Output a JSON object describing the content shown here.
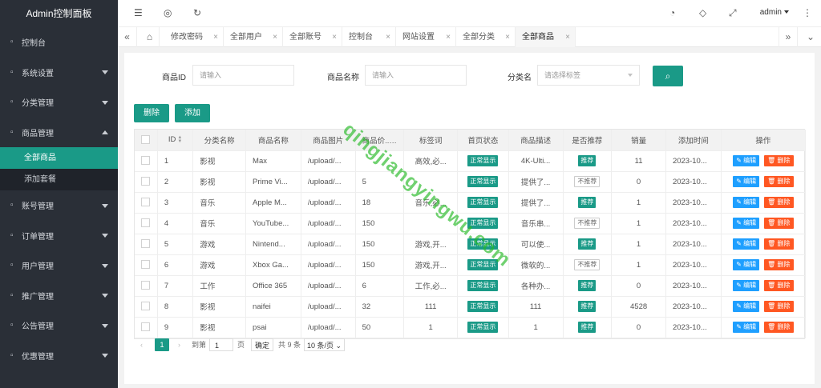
{
  "brand": "Admin控制面板",
  "sidebar": {
    "items": [
      {
        "label": "控制台",
        "icon": "home-icon",
        "caret": ""
      },
      {
        "label": "系统设置",
        "icon": "gear-icon",
        "caret": "down"
      },
      {
        "label": "分类管理",
        "icon": "category-icon",
        "caret": "down"
      },
      {
        "label": "商品管理",
        "icon": "product-icon",
        "caret": "up"
      }
    ],
    "submenu": [
      {
        "label": "全部商品",
        "active": true
      },
      {
        "label": "添加套餐",
        "active": false
      }
    ],
    "items_after": [
      {
        "label": "账号管理",
        "icon": "account-icon",
        "caret": "down"
      },
      {
        "label": "订单管理",
        "icon": "order-icon",
        "caret": "down"
      },
      {
        "label": "用户管理",
        "icon": "user-icon",
        "caret": "down"
      },
      {
        "label": "推广管理",
        "icon": "share-icon",
        "caret": "down"
      },
      {
        "label": "公告管理",
        "icon": "notice-icon",
        "caret": "down"
      },
      {
        "label": "优惠管理",
        "icon": "coupon-icon",
        "caret": "down"
      }
    ]
  },
  "header": {
    "user": "admin"
  },
  "tabs": [
    "修改密码",
    "全部用户",
    "全部账号",
    "控制台",
    "网站设置",
    "全部分类",
    "全部商品"
  ],
  "filters": {
    "id_label": "商品ID",
    "id_placeholder": "请输入",
    "name_label": "商品名称",
    "name_placeholder": "请输入",
    "category_label": "分类名",
    "category_placeholder": "请选择标签"
  },
  "actions": {
    "delete": "删除",
    "add": "添加"
  },
  "table": {
    "columns": [
      "ID",
      "分类名称",
      "商品名称",
      "商品图片",
      "商品价...",
      "标签词",
      "首页状态",
      "商品描述",
      "是否推荐",
      "销量",
      "添加时间",
      "操作"
    ],
    "rows": [
      {
        "id": "1",
        "category": "影视",
        "name": "Max",
        "image": "/upload/...",
        "price": "",
        "tags": "高效,必...",
        "status": "正常显示",
        "desc": "4K-Ulti...",
        "recommend": "推荐",
        "sales": "11",
        "time": "2023-10..."
      },
      {
        "id": "2",
        "category": "影视",
        "name": "Prime Vi...",
        "image": "/upload/...",
        "price": "5",
        "tags": "",
        "status": "正常显示",
        "desc": "提供了...",
        "recommend": "不推荐",
        "sales": "0",
        "time": "2023-10..."
      },
      {
        "id": "3",
        "category": "音乐",
        "name": "Apple M...",
        "image": "/upload/...",
        "price": "18",
        "tags": "音乐,必...",
        "status": "正常显示",
        "desc": "提供了...",
        "recommend": "推荐",
        "sales": "1",
        "time": "2023-10..."
      },
      {
        "id": "4",
        "category": "音乐",
        "name": "YouTube...",
        "image": "/upload/...",
        "price": "150",
        "tags": "",
        "status": "正常显示",
        "desc": "音乐串...",
        "recommend": "不推荐",
        "sales": "1",
        "time": "2023-10..."
      },
      {
        "id": "5",
        "category": "游戏",
        "name": "Nintend...",
        "image": "/upload/...",
        "price": "150",
        "tags": "游戏,开...",
        "status": "正常显示",
        "desc": "可以使...",
        "recommend": "推荐",
        "sales": "1",
        "time": "2023-10..."
      },
      {
        "id": "6",
        "category": "游戏",
        "name": "Xbox Ga...",
        "image": "/upload/...",
        "price": "150",
        "tags": "游戏,开...",
        "status": "正常显示",
        "desc": "微软的...",
        "recommend": "不推荐",
        "sales": "1",
        "time": "2023-10..."
      },
      {
        "id": "7",
        "category": "工作",
        "name": "Office 365",
        "image": "/upload/...",
        "price": "6",
        "tags": "工作,必...",
        "status": "正常显示",
        "desc": "各种办...",
        "recommend": "推荐",
        "sales": "0",
        "time": "2023-10..."
      },
      {
        "id": "8",
        "category": "影视",
        "name": "naifei",
        "image": "/upload/...",
        "price": "32",
        "tags": "111",
        "status": "正常显示",
        "desc": "111",
        "recommend": "推荐",
        "sales": "4528",
        "time": "2023-10..."
      },
      {
        "id": "9",
        "category": "影视",
        "name": "psai",
        "image": "/upload/...",
        "price": "50",
        "tags": "1",
        "status": "正常显示",
        "desc": "1",
        "recommend": "推荐",
        "sales": "0",
        "time": "2023-10..."
      }
    ],
    "edit_label": "编辑",
    "delete_label": "删除"
  },
  "pager": {
    "current": "1",
    "goto_label": "到第",
    "page_input": "1",
    "page_unit": "页",
    "confirm": "确定",
    "total": "共 9 条",
    "page_size": "10 条/页"
  },
  "watermark": "qingjiangyingwu.com",
  "colors": {
    "sidebar_bg": "#2a2f37",
    "accent": "#1a9a87",
    "edit": "#1e9fff",
    "delete": "#ff5722"
  }
}
